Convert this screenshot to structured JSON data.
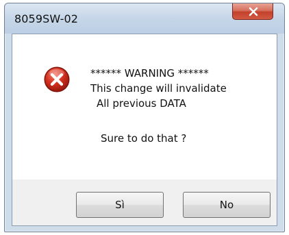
{
  "window": {
    "title": "8059SW-02"
  },
  "message": {
    "line1": "****** WARNING ******",
    "line2": "This change will invalidate",
    "line3": "All previous DATA",
    "line4": "Sure to do that ?"
  },
  "buttons": {
    "yes_label": "Sì",
    "no_label": "No"
  },
  "icons": {
    "title_close": "close-icon",
    "message": "error-icon"
  },
  "colors": {
    "error_red": "#c42b1c",
    "close_button": "#c2412b"
  }
}
